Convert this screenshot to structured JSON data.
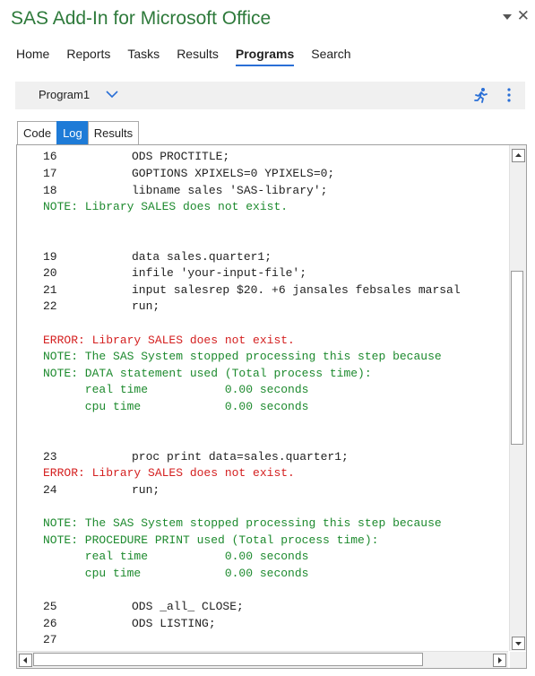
{
  "app": {
    "title": "SAS Add-In for Microsoft Office"
  },
  "menu": [
    "Home",
    "Reports",
    "Tasks",
    "Results",
    "Programs",
    "Search"
  ],
  "menu_active": "Programs",
  "program": {
    "name": "Program1"
  },
  "tabs": [
    "Code",
    "Log",
    "Results"
  ],
  "tab_active": "Log",
  "log": {
    "l16": {
      "num": "16",
      "text": "ODS PROCTITLE;"
    },
    "l17": {
      "num": "17",
      "text": "GOPTIONS XPIXELS=0 YPIXELS=0;"
    },
    "l18": {
      "num": "18",
      "text": "libname sales 'SAS-library';"
    },
    "n1": "NOTE: Library SALES does not exist.",
    "l19": {
      "num": "19",
      "text": "data sales.quarter1;"
    },
    "l20": {
      "num": "20",
      "text": "infile 'your-input-file';"
    },
    "l21": {
      "num": "21",
      "text": "input salesrep $20. +6 jansales febsales marsal"
    },
    "l22": {
      "num": "22",
      "text": "run;"
    },
    "e1": "ERROR: Library SALES does not exist.",
    "n2": "NOTE: The SAS System stopped processing this step because",
    "n3": "NOTE: DATA statement used (Total process time):",
    "n4": "      real time           0.00 seconds",
    "n5": "      cpu time            0.00 seconds",
    "l23": {
      "num": "23",
      "text": "proc print data=sales.quarter1;"
    },
    "e2": "ERROR: Library SALES does not exist.",
    "l24": {
      "num": "24",
      "text": "run;"
    },
    "n6": "NOTE: The SAS System stopped processing this step because",
    "n7": "NOTE: PROCEDURE PRINT used (Total process time):",
    "n8": "      real time           0.00 seconds",
    "n9": "      cpu time            0.00 seconds",
    "l25": {
      "num": "25",
      "text": "ODS _all_ CLOSE;"
    },
    "l26": {
      "num": "26",
      "text": "ODS LISTING;"
    },
    "l27": {
      "num": "27",
      "text": ""
    }
  },
  "colors": {
    "title": "#2e7a3b",
    "note": "#1d8a2e",
    "error": "#d42020",
    "accent": "#1e7bd7"
  },
  "icons": [
    "dropdown-triangle-icon",
    "close-icon",
    "chevron-down-icon",
    "run-icon",
    "more-vertical-icon",
    "scroll-up-icon",
    "scroll-down-icon",
    "scroll-left-icon",
    "scroll-right-icon"
  ]
}
